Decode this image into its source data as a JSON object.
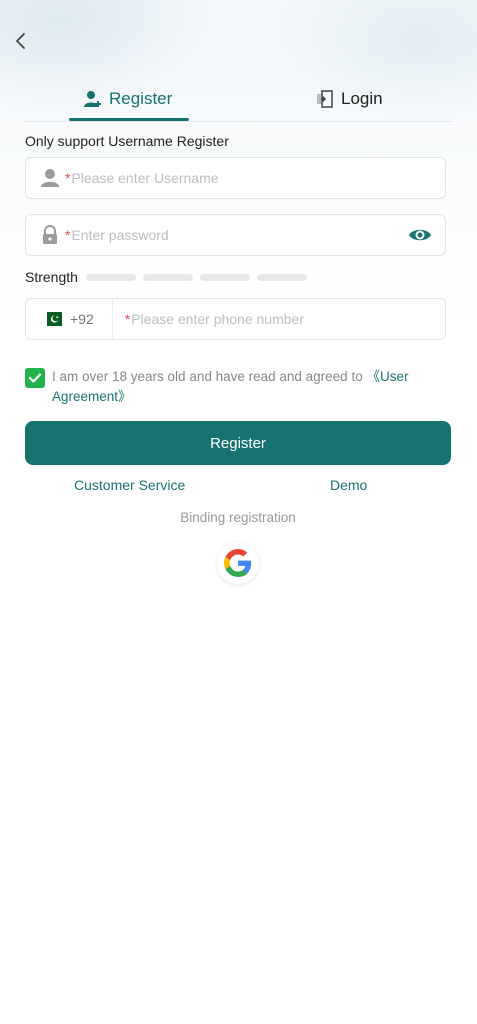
{
  "tabs": {
    "register_label": "Register",
    "login_label": "Login"
  },
  "hint": "Only support Username Register",
  "username": {
    "required_mark": "*",
    "placeholder": "Please enter Username",
    "value": ""
  },
  "password": {
    "required_mark": "*",
    "placeholder": "Enter password",
    "value": ""
  },
  "strength": {
    "label": "Strength",
    "segments": 4,
    "filled": 0
  },
  "phone": {
    "country_code": "+92",
    "required_mark": "*",
    "placeholder": "Please enter phone number",
    "value": ""
  },
  "agreement": {
    "checked": true,
    "text": "I am over 18 years old and have read and agreed to ",
    "link": "《User Agreement》"
  },
  "register_button": "Register",
  "links": {
    "customer_service": "Customer Service",
    "demo": "Demo"
  },
  "binding_label": "Binding registration",
  "colors": {
    "accent": "#177370",
    "checkbox": "#22b24c",
    "required": "#e24c4c"
  },
  "icons": [
    "back-icon",
    "register-user-icon",
    "login-door-icon",
    "user-icon",
    "lock-icon",
    "eye-icon",
    "pakistan-flag-icon",
    "check-icon",
    "google-icon"
  ]
}
